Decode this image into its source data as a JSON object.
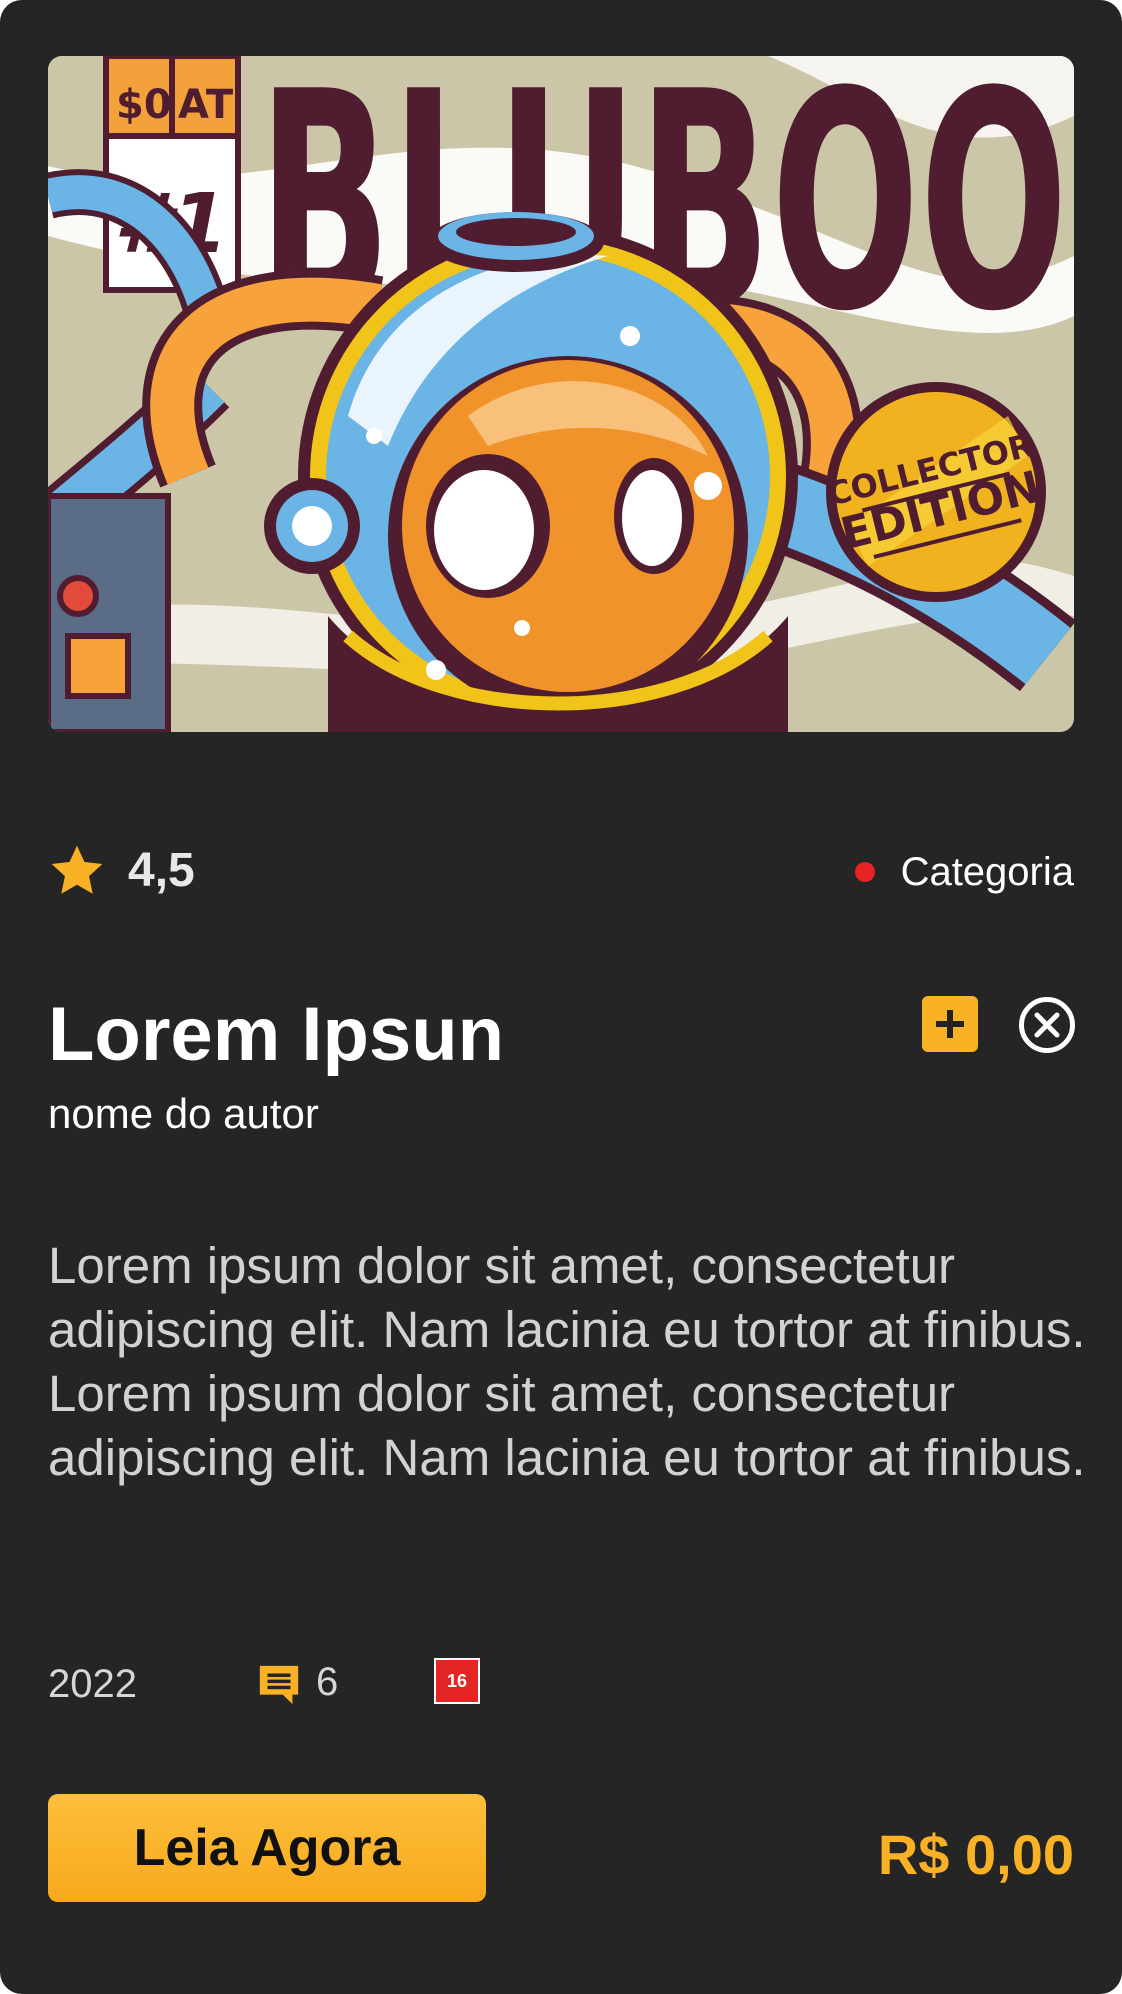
{
  "cover": {
    "corner_box": {
      "top_left": "$0",
      "top_right": "AT",
      "issue": "#1"
    },
    "masthead": "BLUBOO",
    "seal_line1": "COLLECTOR",
    "seal_line2": "EDITION"
  },
  "rating": {
    "value": "4,5",
    "icon": "star-icon"
  },
  "category": {
    "label": "Categoria",
    "dot_color": "#e52424"
  },
  "book": {
    "title": "Lorem Ipsun",
    "author": "nome do autor",
    "description": "Lorem ipsum dolor sit amet, consectetur adipiscing elit. Nam lacinia eu tortor at finibus. Lorem ipsum dolor sit amet, consectetur adipiscing elit. Nam lacinia eu tortor at finibus."
  },
  "actions": {
    "add_icon": "plus-icon",
    "close_icon": "close-circle-icon"
  },
  "meta": {
    "year": "2022",
    "comments": "6",
    "comment_icon": "comment-icon",
    "age_rating": "16"
  },
  "cta": {
    "label": "Leia Agora"
  },
  "price": "R$ 0,00",
  "colors": {
    "background": "#252525",
    "accent": "#f9b225",
    "badge_red": "#e52424"
  }
}
